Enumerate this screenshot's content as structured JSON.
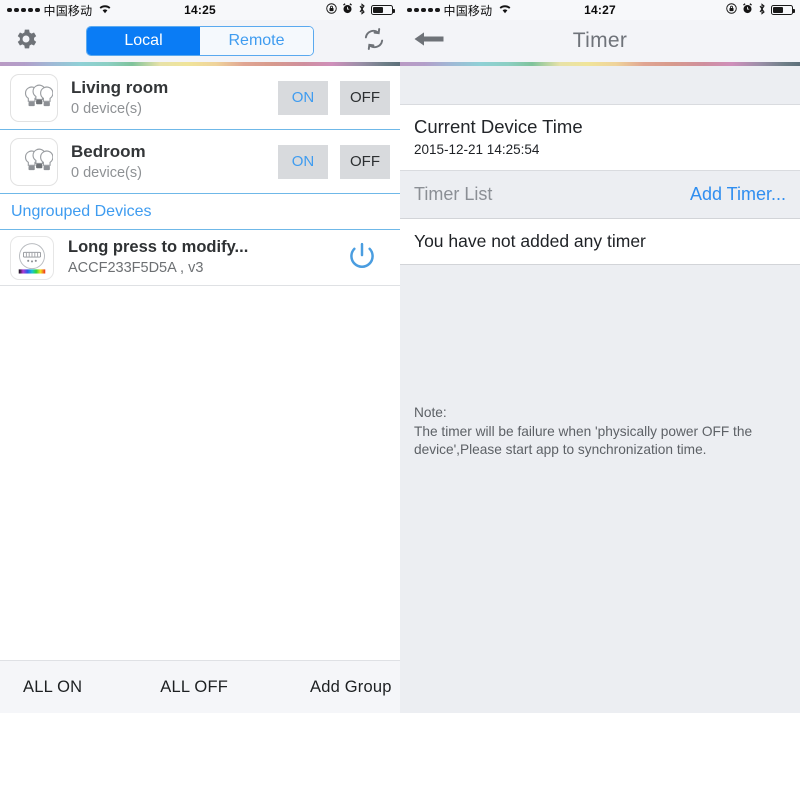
{
  "status_bar": {
    "carrier": "中国移动",
    "signal_dots": 5,
    "wifi_icon": "wifi-icon",
    "time_left": "14:25",
    "time_right": "14:27",
    "right_icons": [
      "rotation-lock-icon",
      "alarm-clock-icon",
      "bluetooth-icon",
      "battery-icon"
    ],
    "battery_level_percent": 55
  },
  "left_screen": {
    "nav": {
      "gear_icon": "gear-icon",
      "refresh_icon": "refresh-icon",
      "segmented": {
        "options": [
          "Local",
          "Remote"
        ],
        "selected": "Local"
      }
    },
    "groups": [
      {
        "name": "Living room",
        "subtitle": "0 device(s)",
        "icon": "bulb-group-icon",
        "on_label": "ON",
        "off_label": "OFF"
      },
      {
        "name": "Bedroom",
        "subtitle": "0 device(s)",
        "icon": "bulb-group-icon",
        "on_label": "ON",
        "off_label": "OFF"
      }
    ],
    "section_header": "Ungrouped Devices",
    "devices": [
      {
        "name": "Long press to modify...",
        "subtitle": "ACCF233F5D5A , v3",
        "icon": "rgb-controller-icon",
        "power_icon": "power-icon"
      }
    ],
    "toolbar": {
      "all_on": "ALL ON",
      "all_off": "ALL OFF",
      "add_group": "Add Group"
    }
  },
  "right_screen": {
    "nav": {
      "back_icon": "back-arrow-icon",
      "title": "Timer"
    },
    "current_device_time": {
      "label": "Current Device Time",
      "value": "2015-12-21 14:25:54"
    },
    "timer_list": {
      "label": "Timer List",
      "add_label": "Add Timer...",
      "empty_message": "You have not added any timer"
    },
    "note": "Note:\nThe timer will be failure when 'physically power OFF the device',Please start app to synchronization time."
  },
  "colors": {
    "accent_blue": "#0a7cf5",
    "link_blue": "#2f8ef0",
    "nav_bg": "#f3f4f8",
    "panel_bg": "#eceef2",
    "button_gray": "#d8dadd"
  }
}
